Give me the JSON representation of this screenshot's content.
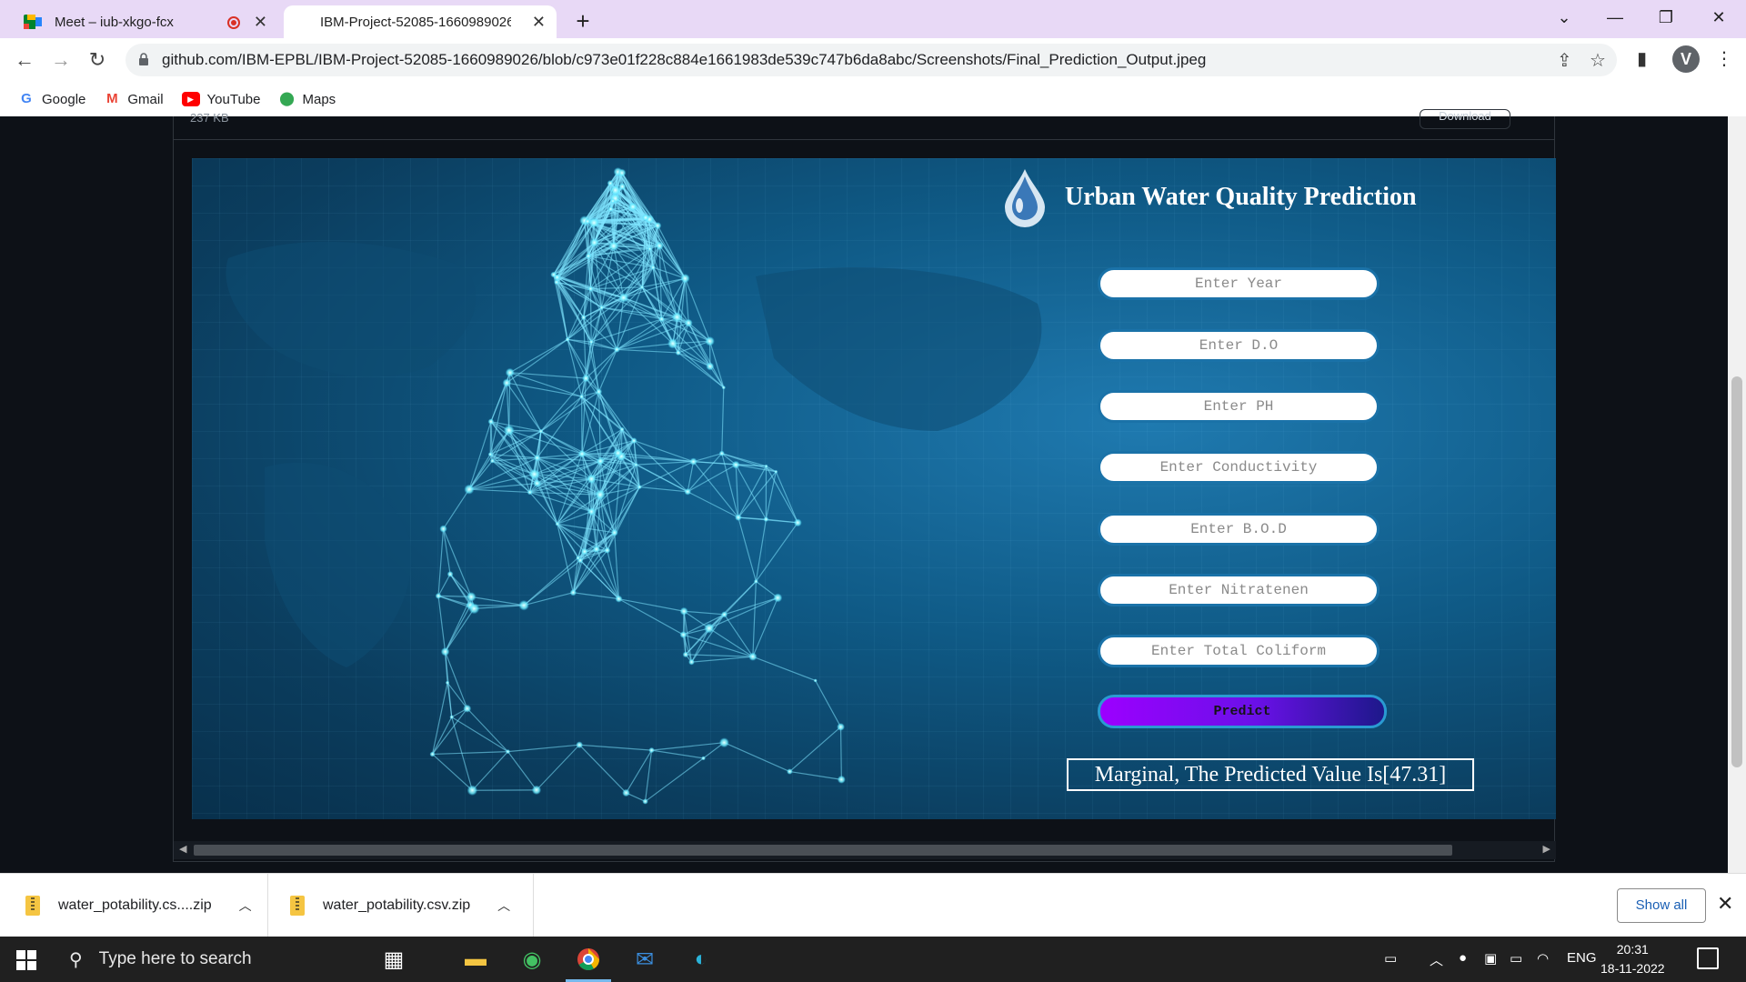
{
  "browser": {
    "tabs": [
      {
        "title": "Meet – iub-xkgo-fcx",
        "recording": true
      },
      {
        "title": "IBM-Project-52085-1660989026/",
        "active": true
      }
    ],
    "url": "github.com/IBM-EPBL/IBM-Project-52085-1660989026/blob/c973e01f228c884e1661983de539c747b6da8abc/Screenshots/Final_Prediction_Output.jpeg",
    "profile_initial": "V",
    "bookmarks": [
      {
        "label": "Google",
        "icon": "google-icon"
      },
      {
        "label": "Gmail",
        "icon": "gmail-icon"
      },
      {
        "label": "YouTube",
        "icon": "youtube-icon"
      },
      {
        "label": "Maps",
        "icon": "maps-icon"
      }
    ]
  },
  "viewer": {
    "size_label": "237 KB",
    "download_label": "Download"
  },
  "app": {
    "title": "Urban Water Quality Prediction",
    "fields": [
      {
        "placeholder": "Enter Year"
      },
      {
        "placeholder": "Enter D.O"
      },
      {
        "placeholder": "Enter PH"
      },
      {
        "placeholder": "Enter Conductivity"
      },
      {
        "placeholder": "Enter B.O.D"
      },
      {
        "placeholder": "Enter Nitratenen"
      },
      {
        "placeholder": "Enter Total Coliform"
      }
    ],
    "predict_label": "Predict",
    "result": "Marginal, The Predicted Value Is[47.31]"
  },
  "downloads": {
    "items": [
      {
        "name": "water_potability.cs....zip"
      },
      {
        "name": "water_potability.csv.zip"
      }
    ],
    "show_all_label": "Show all"
  },
  "taskbar": {
    "search_placeholder": "Type here to search",
    "language": "ENG",
    "time": "20:31",
    "date": "18-11-2022"
  },
  "colors": {
    "tab_strip": "#e8d9f6",
    "predict_gradient_start": "#9c00ff",
    "predict_gradient_end": "#1d188a",
    "app_background": "#0f5a86"
  }
}
